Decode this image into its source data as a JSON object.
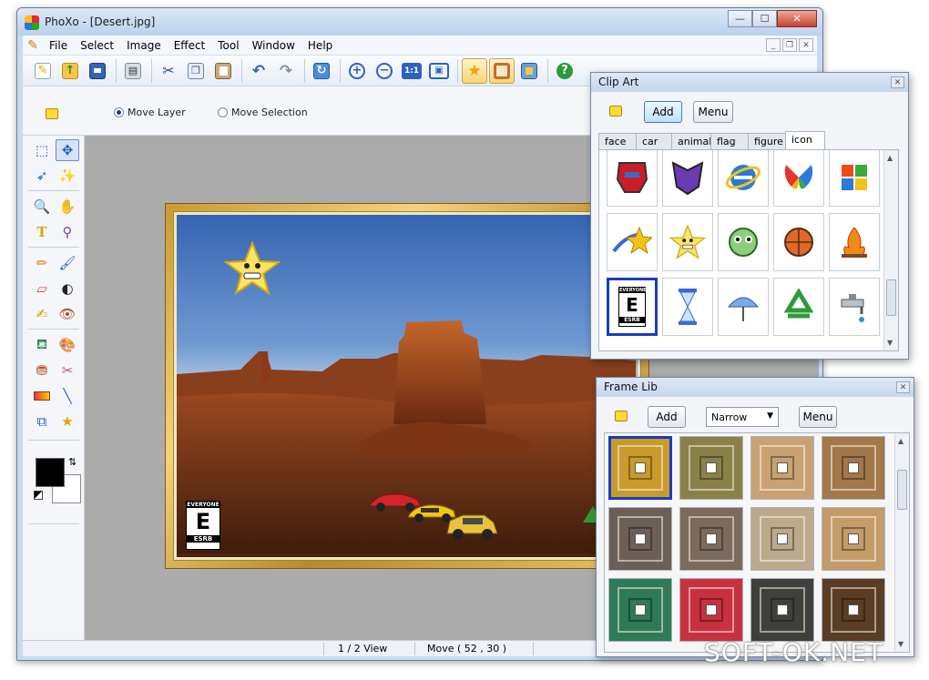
{
  "window": {
    "title": "PhoXo - [Desert.jpg]",
    "minimize": "—",
    "maximize": "☐",
    "close": "✕"
  },
  "menu": [
    "File",
    "Select",
    "Image",
    "Effect",
    "Tool",
    "Window",
    "Help"
  ],
  "toolbar_icons": [
    "new-icon",
    "open-icon",
    "save-icon",
    "print-icon",
    "cut-icon",
    "copy-icon",
    "paste-icon",
    "undo-icon",
    "redo-icon",
    "refresh-icon",
    "zoom-in-icon",
    "zoom-out-icon",
    "actual-size-icon",
    "fit-window-icon",
    "clipart-panel-icon",
    "frame-panel-icon",
    "layers-panel-icon",
    "help-icon"
  ],
  "options": {
    "move_layer": "Move Layer",
    "move_selection": "Move Selection",
    "selected": "move_layer"
  },
  "canvas": {
    "badge_top": "EVERYONE",
    "badge_letter": "E",
    "badge_bottom": "ESRB"
  },
  "status": {
    "view": "1 / 2 View",
    "position": "Move ( 52 , 30 )"
  },
  "clip_art": {
    "title": "Clip Art",
    "add_label": "Add",
    "menu_label": "Menu",
    "tabs": [
      "face",
      "car",
      "animal",
      "flag",
      "figure",
      "icon"
    ],
    "active_tab": "icon",
    "items": [
      "autobot-icon",
      "decepticon-icon",
      "ie-logo-icon",
      "msn-butterfly-icon",
      "windows-logo-icon",
      "shooting-star-icon",
      "smiley-star-icon",
      "green-monster-icon",
      "basketball-icon",
      "campfire-icon",
      "esrb-everyone-icon",
      "hourglass-icon",
      "umbrella-icon",
      "recycle-icon",
      "faucet-icon"
    ],
    "esrb_top": "EVERYONE",
    "esrb_letter": "E",
    "esrb_bottom": "ESRB"
  },
  "frame_lib": {
    "title": "Frame Lib",
    "add_label": "Add",
    "style_value": "Narrow",
    "menu_label": "Menu",
    "frames": [
      {
        "color": "#c99b2c"
      },
      {
        "color": "#8a8148"
      },
      {
        "color": "#c9a274"
      },
      {
        "color": "#a2774a"
      },
      {
        "color": "#6c5f57"
      },
      {
        "color": "#7c6a5b"
      },
      {
        "color": "#bca98c"
      },
      {
        "color": "#c49c6a"
      },
      {
        "color": "#2f7a57"
      },
      {
        "color": "#c8323e"
      },
      {
        "color": "#3f3f3b"
      },
      {
        "color": "#5a3d24"
      }
    ]
  },
  "watermark": "SOFT-OK.NET"
}
